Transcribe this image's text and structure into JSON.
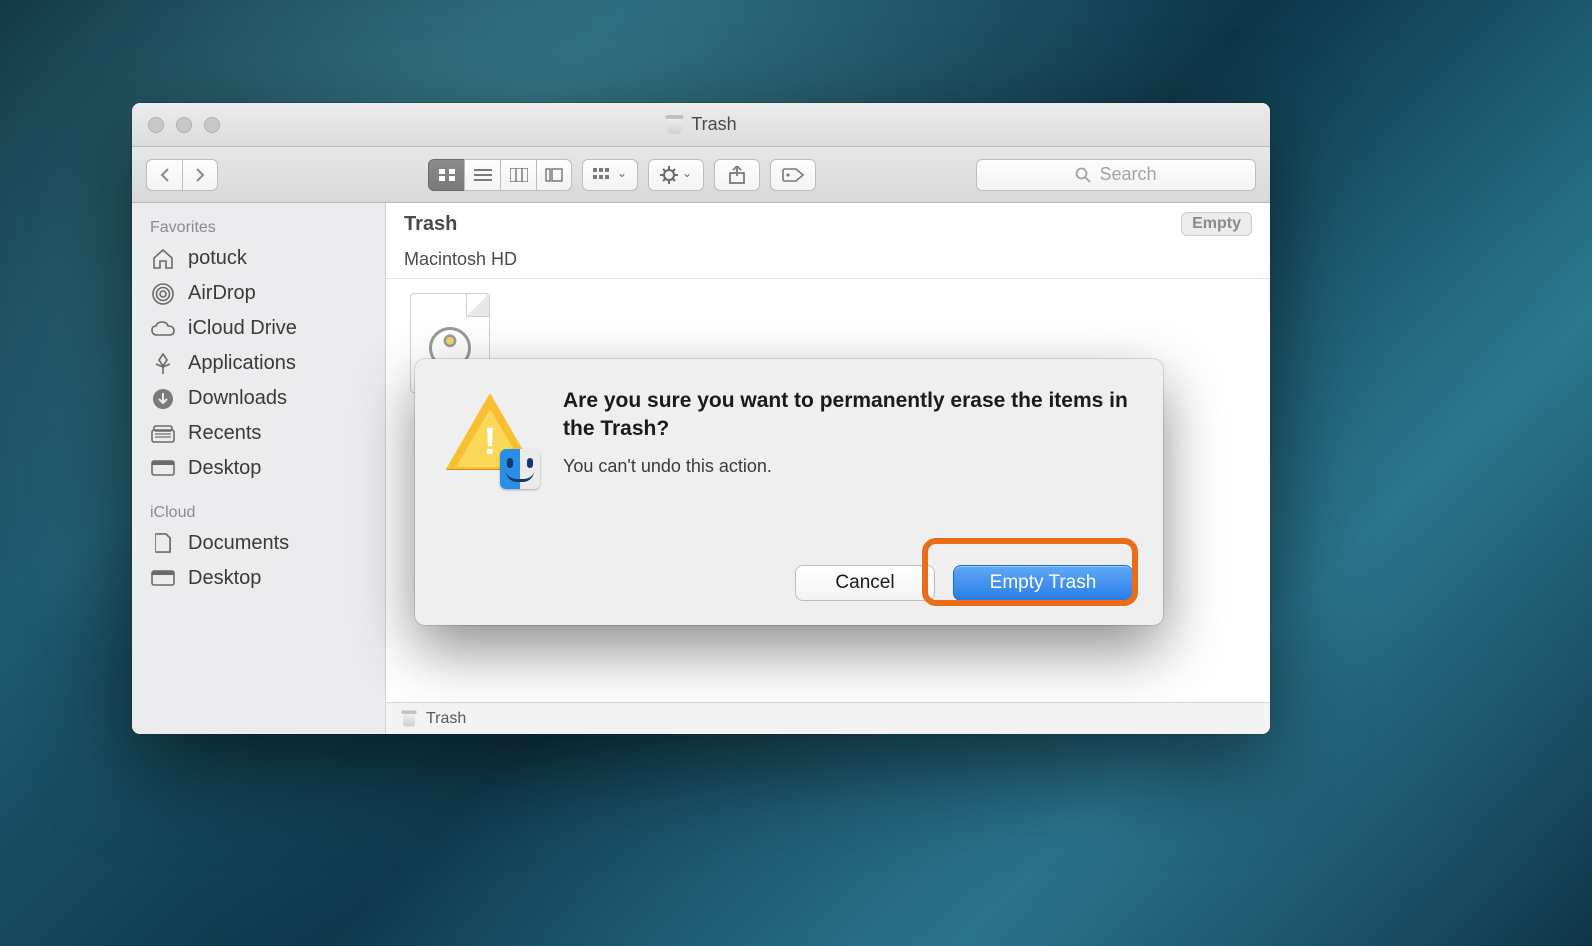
{
  "window": {
    "title": "Trash"
  },
  "toolbar": {
    "search_placeholder": "Search"
  },
  "sidebar": {
    "sections": [
      {
        "title": "Favorites",
        "items": [
          {
            "icon": "home-icon",
            "label": "potuck"
          },
          {
            "icon": "airdrop-icon",
            "label": "AirDrop"
          },
          {
            "icon": "icloud-drive-icon",
            "label": "iCloud Drive"
          },
          {
            "icon": "applications-icon",
            "label": "Applications"
          },
          {
            "icon": "downloads-icon",
            "label": "Downloads"
          },
          {
            "icon": "recents-icon",
            "label": "Recents"
          },
          {
            "icon": "desktop-icon",
            "label": "Desktop"
          }
        ]
      },
      {
        "title": "iCloud",
        "items": [
          {
            "icon": "documents-icon",
            "label": "Documents"
          },
          {
            "icon": "desktop-icon",
            "label": "Desktop"
          }
        ]
      }
    ]
  },
  "main": {
    "path_title": "Trash",
    "empty_button": "Empty",
    "volume": "Macintosh HD",
    "path_bar": "Trash"
  },
  "dialog": {
    "title": "Are you sure you want to permanently erase the items in the Trash?",
    "subtitle": "You can't undo this action.",
    "cancel": "Cancel",
    "confirm": "Empty Trash"
  }
}
